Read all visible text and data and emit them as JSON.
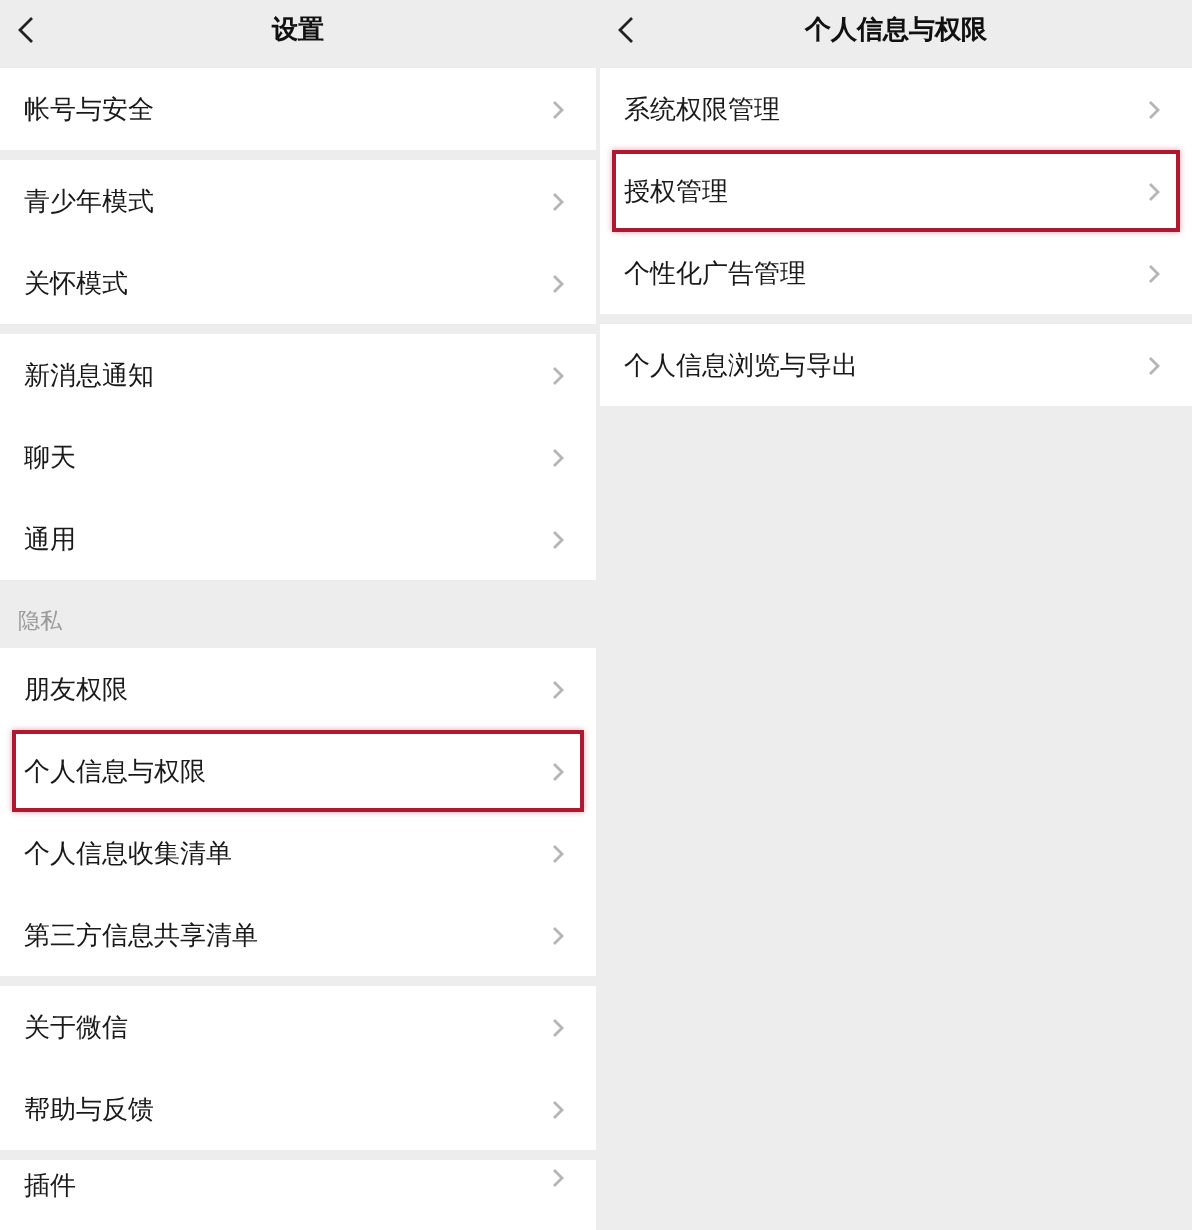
{
  "screens": [
    {
      "title": "设置",
      "groups": [
        {
          "items": [
            {
              "label": "帐号与安全",
              "highlighted": false
            }
          ]
        },
        {
          "items": [
            {
              "label": "青少年模式",
              "highlighted": false
            },
            {
              "label": "关怀模式",
              "highlighted": false
            }
          ]
        },
        {
          "items": [
            {
              "label": "新消息通知",
              "highlighted": false
            },
            {
              "label": "聊天",
              "highlighted": false
            },
            {
              "label": "通用",
              "highlighted": false
            }
          ]
        },
        {
          "header": "隐私",
          "items": [
            {
              "label": "朋友权限",
              "highlighted": false
            },
            {
              "label": "个人信息与权限",
              "highlighted": true
            },
            {
              "label": "个人信息收集清单",
              "highlighted": false
            },
            {
              "label": "第三方信息共享清单",
              "highlighted": false
            }
          ]
        },
        {
          "items": [
            {
              "label": "关于微信",
              "highlighted": false
            },
            {
              "label": "帮助与反馈",
              "highlighted": false
            }
          ]
        },
        {
          "items": [
            {
              "label": "插件",
              "highlighted": false
            }
          ]
        }
      ]
    },
    {
      "title": "个人信息与权限",
      "groups": [
        {
          "items": [
            {
              "label": "系统权限管理",
              "highlighted": false
            },
            {
              "label": "授权管理",
              "highlighted": true
            },
            {
              "label": "个性化广告管理",
              "highlighted": false
            }
          ]
        },
        {
          "items": [
            {
              "label": "个人信息浏览与导出",
              "highlighted": false
            }
          ]
        }
      ]
    }
  ]
}
